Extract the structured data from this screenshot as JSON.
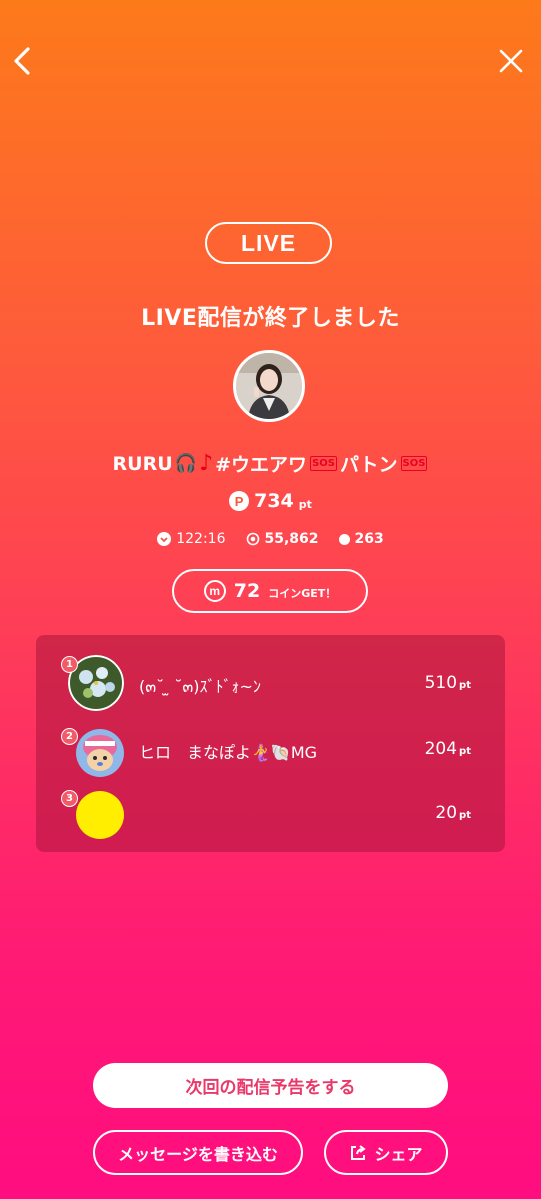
{
  "nav": {
    "back_icon": "chevron-left-icon",
    "close_icon": "close-icon"
  },
  "live_badge": "LIVE",
  "ended_title": "LIVE配信が終了しました",
  "streamer": {
    "name_prefix": "RURU",
    "headphones_glyph": "🎧",
    "note_glyph": "♪",
    "hashtag": "#ウエアワ",
    "sos_1": "SOS",
    "name_suffix": "パトン",
    "sos_2": "SOS"
  },
  "points": {
    "icon_letter": "P",
    "value": "734",
    "unit": "pt"
  },
  "stats": {
    "duration": "122:16",
    "views": "55,862",
    "comments": "263"
  },
  "coins": {
    "icon_letter": "m",
    "value": "72",
    "label": "コインGET！"
  },
  "ranking": [
    {
      "rank": "1",
      "name": "(๓˘ ̫ ˘๓)ｽﾞﾄﾞｫ~ﾝ",
      "score": "510",
      "unit": "pt"
    },
    {
      "rank": "2",
      "name": "ヒロ　まなぽよ🧜‍♀️🐚MG",
      "score": "204",
      "unit": "pt"
    },
    {
      "rank": "3",
      "name": "",
      "score": "20",
      "unit": "pt"
    }
  ],
  "buttons": {
    "next_stream": "次回の配信予告をする",
    "message": "メッセージを書き込む",
    "share": "シェア"
  },
  "colors": {
    "bg_top": "#fd7a1a",
    "bg_bottom": "#ff0d80",
    "accent_pink": "#e8396a",
    "rank3_avatar": "#ffee00"
  }
}
